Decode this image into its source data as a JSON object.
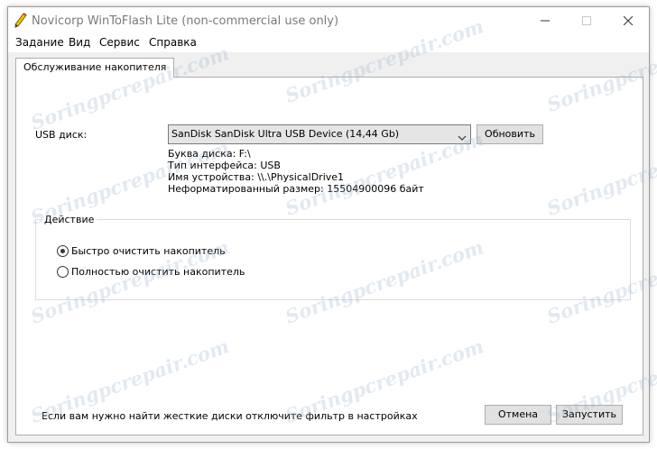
{
  "window": {
    "title": "Novicorp WinToFlash Lite (non-commercial use only)"
  },
  "menu": {
    "items": [
      {
        "label": "Задание"
      },
      {
        "label": "Вид"
      },
      {
        "label": "Сервис"
      },
      {
        "label": "Справка"
      }
    ]
  },
  "tab": {
    "label": "Обслуживание накопителя"
  },
  "usb": {
    "label": "USB диск:",
    "selected": "SanDisk SanDisk Ultra USB Device (14,44 Gb)",
    "refresh_label": "Обновить",
    "info": [
      "Буква диска: F:\\",
      "Тип интерфейса: USB",
      "Имя устройства: \\\\.\\PhysicalDrive1",
      "Неформатированный размер: 15504900096 байт"
    ]
  },
  "action": {
    "title": "Действие",
    "options": [
      {
        "label": "Быстро очистить накопитель",
        "checked": true
      },
      {
        "label": "Полностью очистить накопитель",
        "checked": false
      }
    ]
  },
  "footer": {
    "hint": "Если вам нужно найти жесткие диски отключите фильтр в настройках",
    "cancel_label": "Отмена",
    "start_label": "Запустить"
  },
  "watermark": {
    "text": "Soringpcrepair.com"
  },
  "icons": {
    "app": "pencil-icon",
    "minimize": "minimize-icon",
    "maximize": "maximize-icon",
    "close": "close-icon",
    "dropdown": "chevron-down-icon"
  }
}
